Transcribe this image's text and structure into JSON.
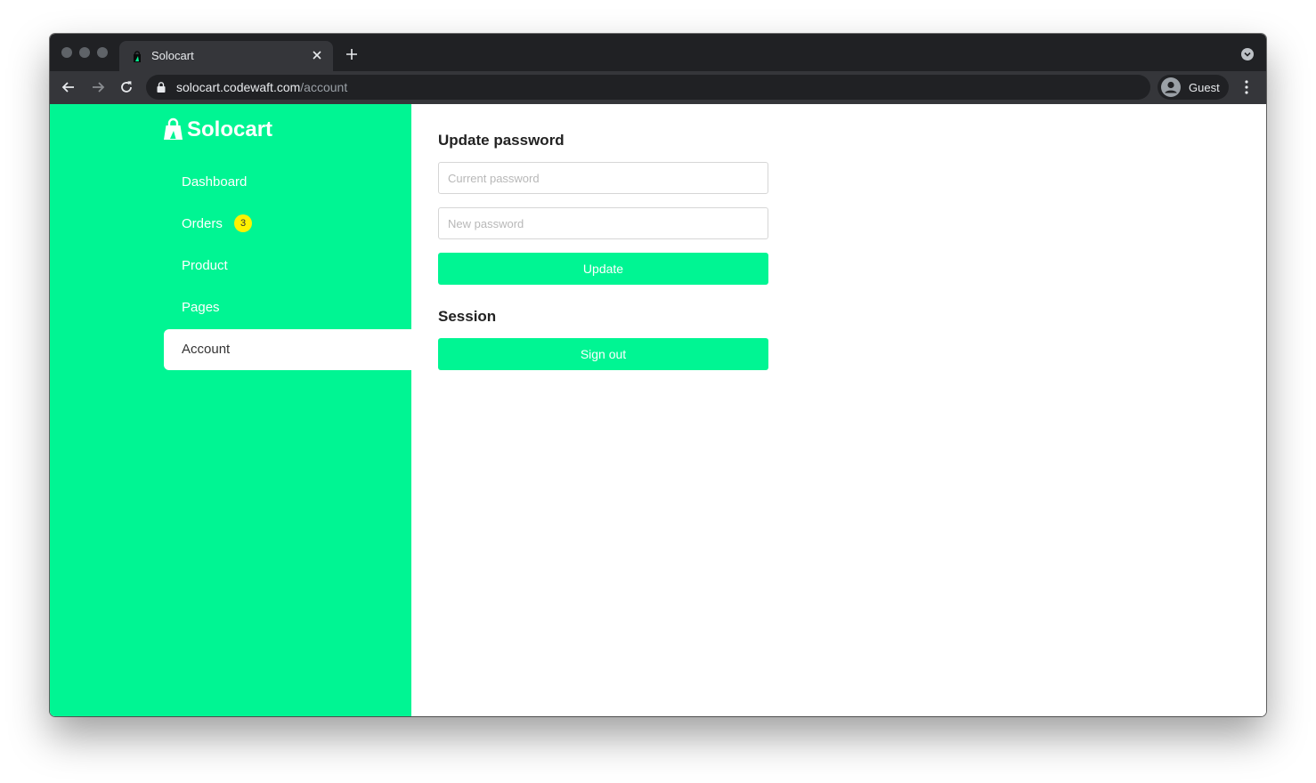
{
  "browser": {
    "tab_title": "Solocart",
    "url_host": "solocart.codewaft.com",
    "url_path": "/account",
    "profile_label": "Guest"
  },
  "sidebar": {
    "brand": "Solocart",
    "items": [
      {
        "label": "Dashboard"
      },
      {
        "label": "Orders",
        "badge": "3"
      },
      {
        "label": "Product"
      },
      {
        "label": "Pages"
      },
      {
        "label": "Account",
        "active": true
      }
    ]
  },
  "main": {
    "update_password": {
      "title": "Update password",
      "current_placeholder": "Current password",
      "new_placeholder": "New password",
      "button_label": "Update"
    },
    "session": {
      "title": "Session",
      "button_label": "Sign out"
    }
  },
  "colors": {
    "accent": "#00f593",
    "badge": "#fff200",
    "browser_frame": "#202124",
    "browser_toolbar": "#35363a"
  },
  "icons": {
    "back": "arrow-left-icon",
    "forward": "arrow-right-icon",
    "reload": "reload-icon",
    "lock": "lock-icon",
    "profile": "user-avatar-icon",
    "menu": "three-dots-vertical-icon",
    "brand": "shopping-bag-icon"
  }
}
